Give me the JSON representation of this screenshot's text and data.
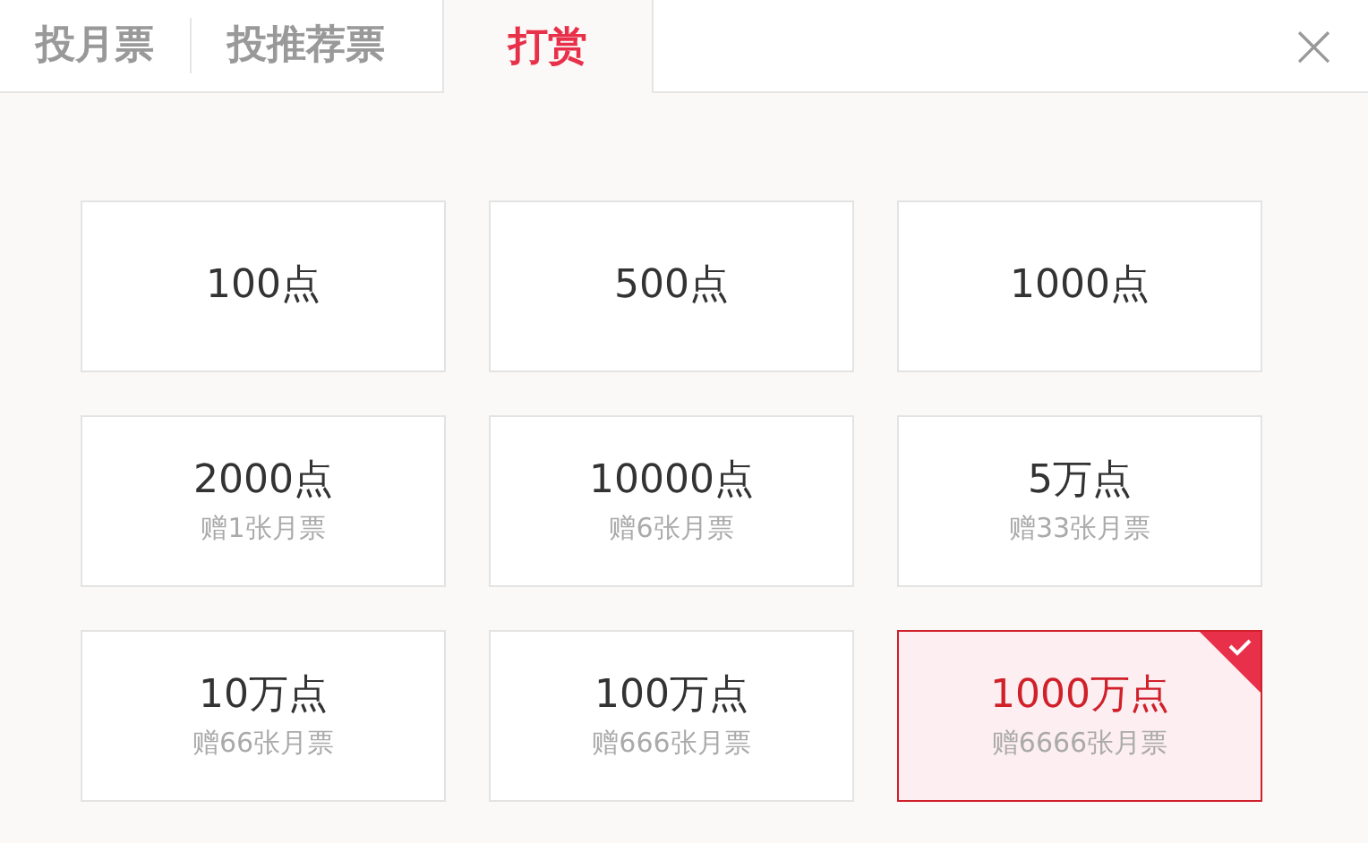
{
  "tabs": [
    {
      "label": "投月票",
      "selected": false
    },
    {
      "label": "投推荐票",
      "selected": false
    },
    {
      "label": "打赏",
      "selected": true
    }
  ],
  "close": "×",
  "options": [
    {
      "amount": "100点",
      "selected": false
    },
    {
      "amount": "500点",
      "selected": false
    },
    {
      "amount": "1000点",
      "selected": false
    },
    {
      "amount": "2000点",
      "bonus": "赠1张月票",
      "selected": false
    },
    {
      "amount": "10000点",
      "bonus": "赠6张月票",
      "selected": false
    },
    {
      "amount": "5万点",
      "bonus": "赠33张月票",
      "selected": false
    },
    {
      "amount": "10万点",
      "bonus": "赠66张月票",
      "selected": false
    },
    {
      "amount": "100万点",
      "bonus": "赠666张月票",
      "selected": false
    },
    {
      "amount": "1000万点",
      "bonus": "赠6666张月票",
      "selected": true
    }
  ]
}
